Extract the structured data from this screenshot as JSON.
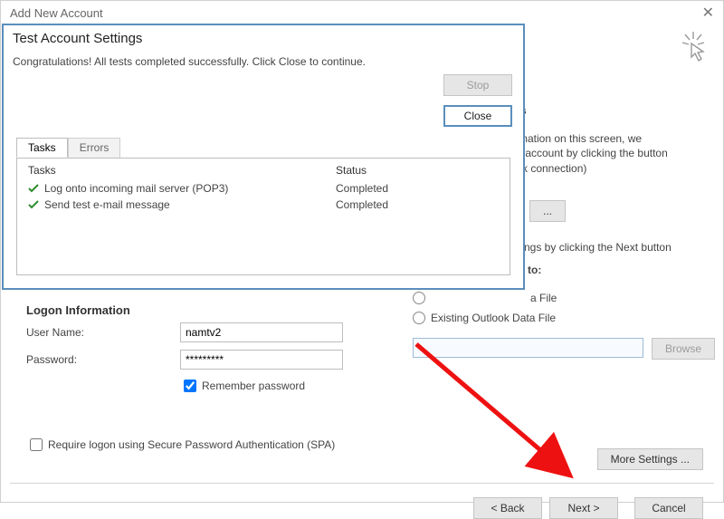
{
  "main": {
    "title": "Add New Account",
    "logon_title": "Logon Information",
    "user_label": "User Name:",
    "user_value": "namtv2",
    "password_label": "Password:",
    "password_value": "*********",
    "remember_label": "Remember password",
    "require_spa_label": "Require logon using Secure Password Authentication (SPA)",
    "more_settings_label": "More Settings ...",
    "back_label": "< Back",
    "next_label": "Next >",
    "cancel_label": "Cancel",
    "browse_label": "Browse"
  },
  "right": {
    "s": "s",
    "line1a": "mation on this screen, we",
    "line1b": "r account by clicking the button",
    "line1c": "rk connection)",
    "ellipsis_btn": "...",
    "line2": "tings by clicking the Next button",
    "s_to": "s to:",
    "a_file": "a File",
    "existing_file": "Existing Outlook Data File"
  },
  "dialog": {
    "title": "Test Account Settings",
    "message": "Congratulations! All tests completed successfully. Click Close to continue.",
    "stop_label": "Stop",
    "close_label": "Close",
    "tab_tasks": "Tasks",
    "tab_errors": "Errors",
    "col_tasks": "Tasks",
    "col_status": "Status",
    "rows": [
      {
        "task": "Log onto incoming mail server (POP3)",
        "status": "Completed"
      },
      {
        "task": "Send test e-mail message",
        "status": "Completed"
      }
    ]
  }
}
